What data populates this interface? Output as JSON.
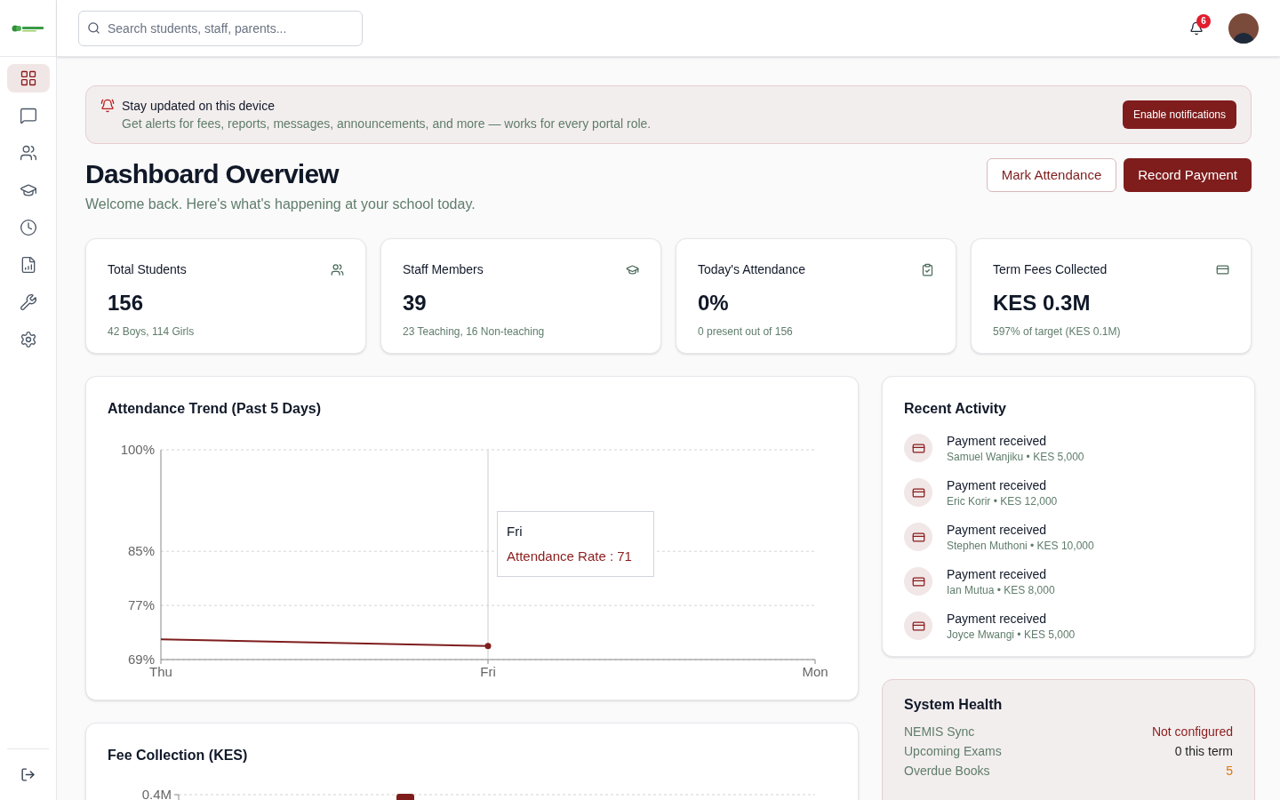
{
  "search": {
    "placeholder": "Search students, staff, parents..."
  },
  "notifications": {
    "count": "6"
  },
  "sidebar": {
    "items": [
      {
        "kind": "dashboard",
        "selected": true
      },
      {
        "kind": "messages",
        "selected": false
      },
      {
        "kind": "people",
        "selected": false
      },
      {
        "kind": "academics",
        "selected": false
      },
      {
        "kind": "history",
        "selected": false
      },
      {
        "kind": "reports",
        "selected": false
      },
      {
        "kind": "tools",
        "selected": false
      },
      {
        "kind": "settings",
        "selected": false
      }
    ]
  },
  "banner": {
    "title": "Stay updated on this device",
    "text": "Get alerts for fees, reports, messages, announcements, and more — works for every portal role.",
    "button": "Enable notifications"
  },
  "page": {
    "title": "Dashboard Overview",
    "subtitle": "Welcome back. Here's what's happening at your school today.",
    "actions": [
      {
        "label": "Mark Attendance",
        "kind": "outline"
      },
      {
        "label": "Record Payment",
        "kind": "primary"
      }
    ]
  },
  "stats": [
    {
      "label": "Total Students",
      "value": "156",
      "note": "42 Boys, 114 Girls",
      "kind": "people"
    },
    {
      "label": "Staff Members",
      "value": "39",
      "note": "23 Teaching, 16 Non-teaching",
      "kind": "academics"
    },
    {
      "label": "Today's Attendance",
      "value": "0%",
      "note": "0 present out of 156",
      "kind": "attendance"
    },
    {
      "label": "Term Fees Collected",
      "value": "KES 0.3M",
      "note": "597% of target (KES 0.1M)",
      "kind": "fees"
    }
  ],
  "attendance": {
    "title": "Attendance Trend (Past 5 Days)",
    "chart_data": {
      "type": "line",
      "categories": [
        "Thu",
        "Fri",
        "Mon"
      ],
      "series": [
        {
          "name": "Attendance Rate",
          "color": "#7f1d1d",
          "values": [
            72,
            71,
            null
          ]
        }
      ],
      "ref_lines": [
        {
          "axis": "x",
          "value": "Fri",
          "color": "#cccccc"
        }
      ],
      "ylim": [
        69,
        100
      ],
      "yticks": [
        {
          "value": 100,
          "label": "100%"
        },
        {
          "value": 85,
          "label": "85%"
        },
        {
          "value": 77,
          "label": "77%"
        },
        {
          "value": 69,
          "label": "69%"
        }
      ]
    },
    "tooltip": {
      "category": "Fri",
      "separator": ":",
      "value": "71"
    }
  },
  "fees": {
    "title": "Fee Collection (KES)",
    "tick": "0.4M"
  },
  "activity": {
    "title": "Recent Activity",
    "items": [
      {
        "title": "Payment received",
        "detail": "Samuel Wanjiku • KES 5,000"
      },
      {
        "title": "Payment received",
        "detail": "Eric Korir • KES 12,000"
      },
      {
        "title": "Payment received",
        "detail": "Stephen Muthoni • KES 10,000"
      },
      {
        "title": "Payment received",
        "detail": "Ian Mutua • KES 8,000"
      },
      {
        "title": "Payment received",
        "detail": "Joyce Mwangi • KES 5,000"
      }
    ]
  },
  "health": {
    "title": "System Health",
    "rows": [
      {
        "label": "NEMIS Sync",
        "value": "Not configured",
        "color": "#8b1c1c"
      },
      {
        "label": "Upcoming Exams",
        "value": "0 this term",
        "color": "#1f1f1f"
      },
      {
        "label": "Overdue Books",
        "value": "5",
        "color": "#d97706"
      }
    ]
  }
}
